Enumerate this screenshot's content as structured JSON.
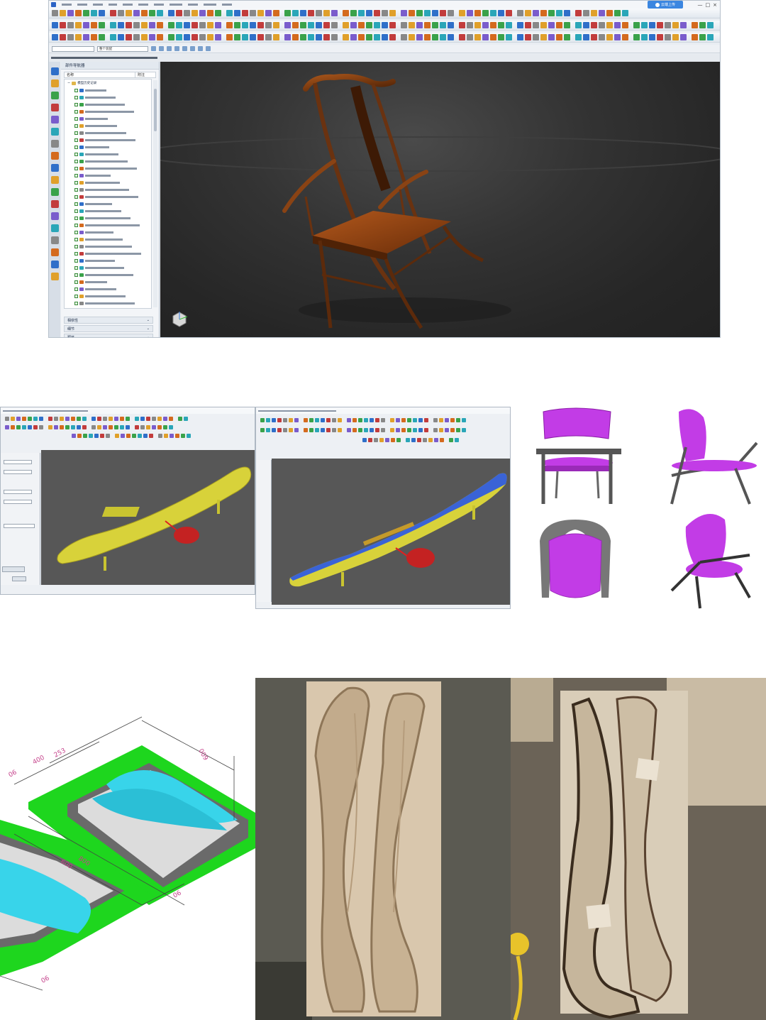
{
  "nx_window": {
    "cloud_button": "云端上传",
    "window_controls": [
      "—",
      "□",
      "×"
    ],
    "selection_filter": "整个装配",
    "navigator": {
      "title": "部件导航器",
      "col_name": "名称",
      "col_updated": "附注",
      "root": "模型历史记录",
      "sections": [
        "相依性",
        "细节",
        "预览"
      ]
    }
  },
  "colors": {
    "toolbar_bg": "#e9edf2",
    "viewport_bg": "#2a2a2a",
    "cam_viewport_bg": "#575757",
    "part_yellow": "#d8d23a",
    "toolpath_blue": "#3a63d6",
    "render_magenta": "#c23ce6",
    "mold_cyan": "#38d4ea",
    "mold_green": "#1ed61e",
    "wood": "#d9c7ad"
  },
  "icons": [
    "app-icon",
    "cloud-upload-icon",
    "view-triad-icon",
    "folder-icon",
    "feature-check-icon",
    "tool-cylinder-icon"
  ],
  "mold_drawing": {
    "dimensions": [
      "400",
      "253",
      "009",
      "600",
      "800",
      "06",
      "06",
      "06"
    ]
  }
}
